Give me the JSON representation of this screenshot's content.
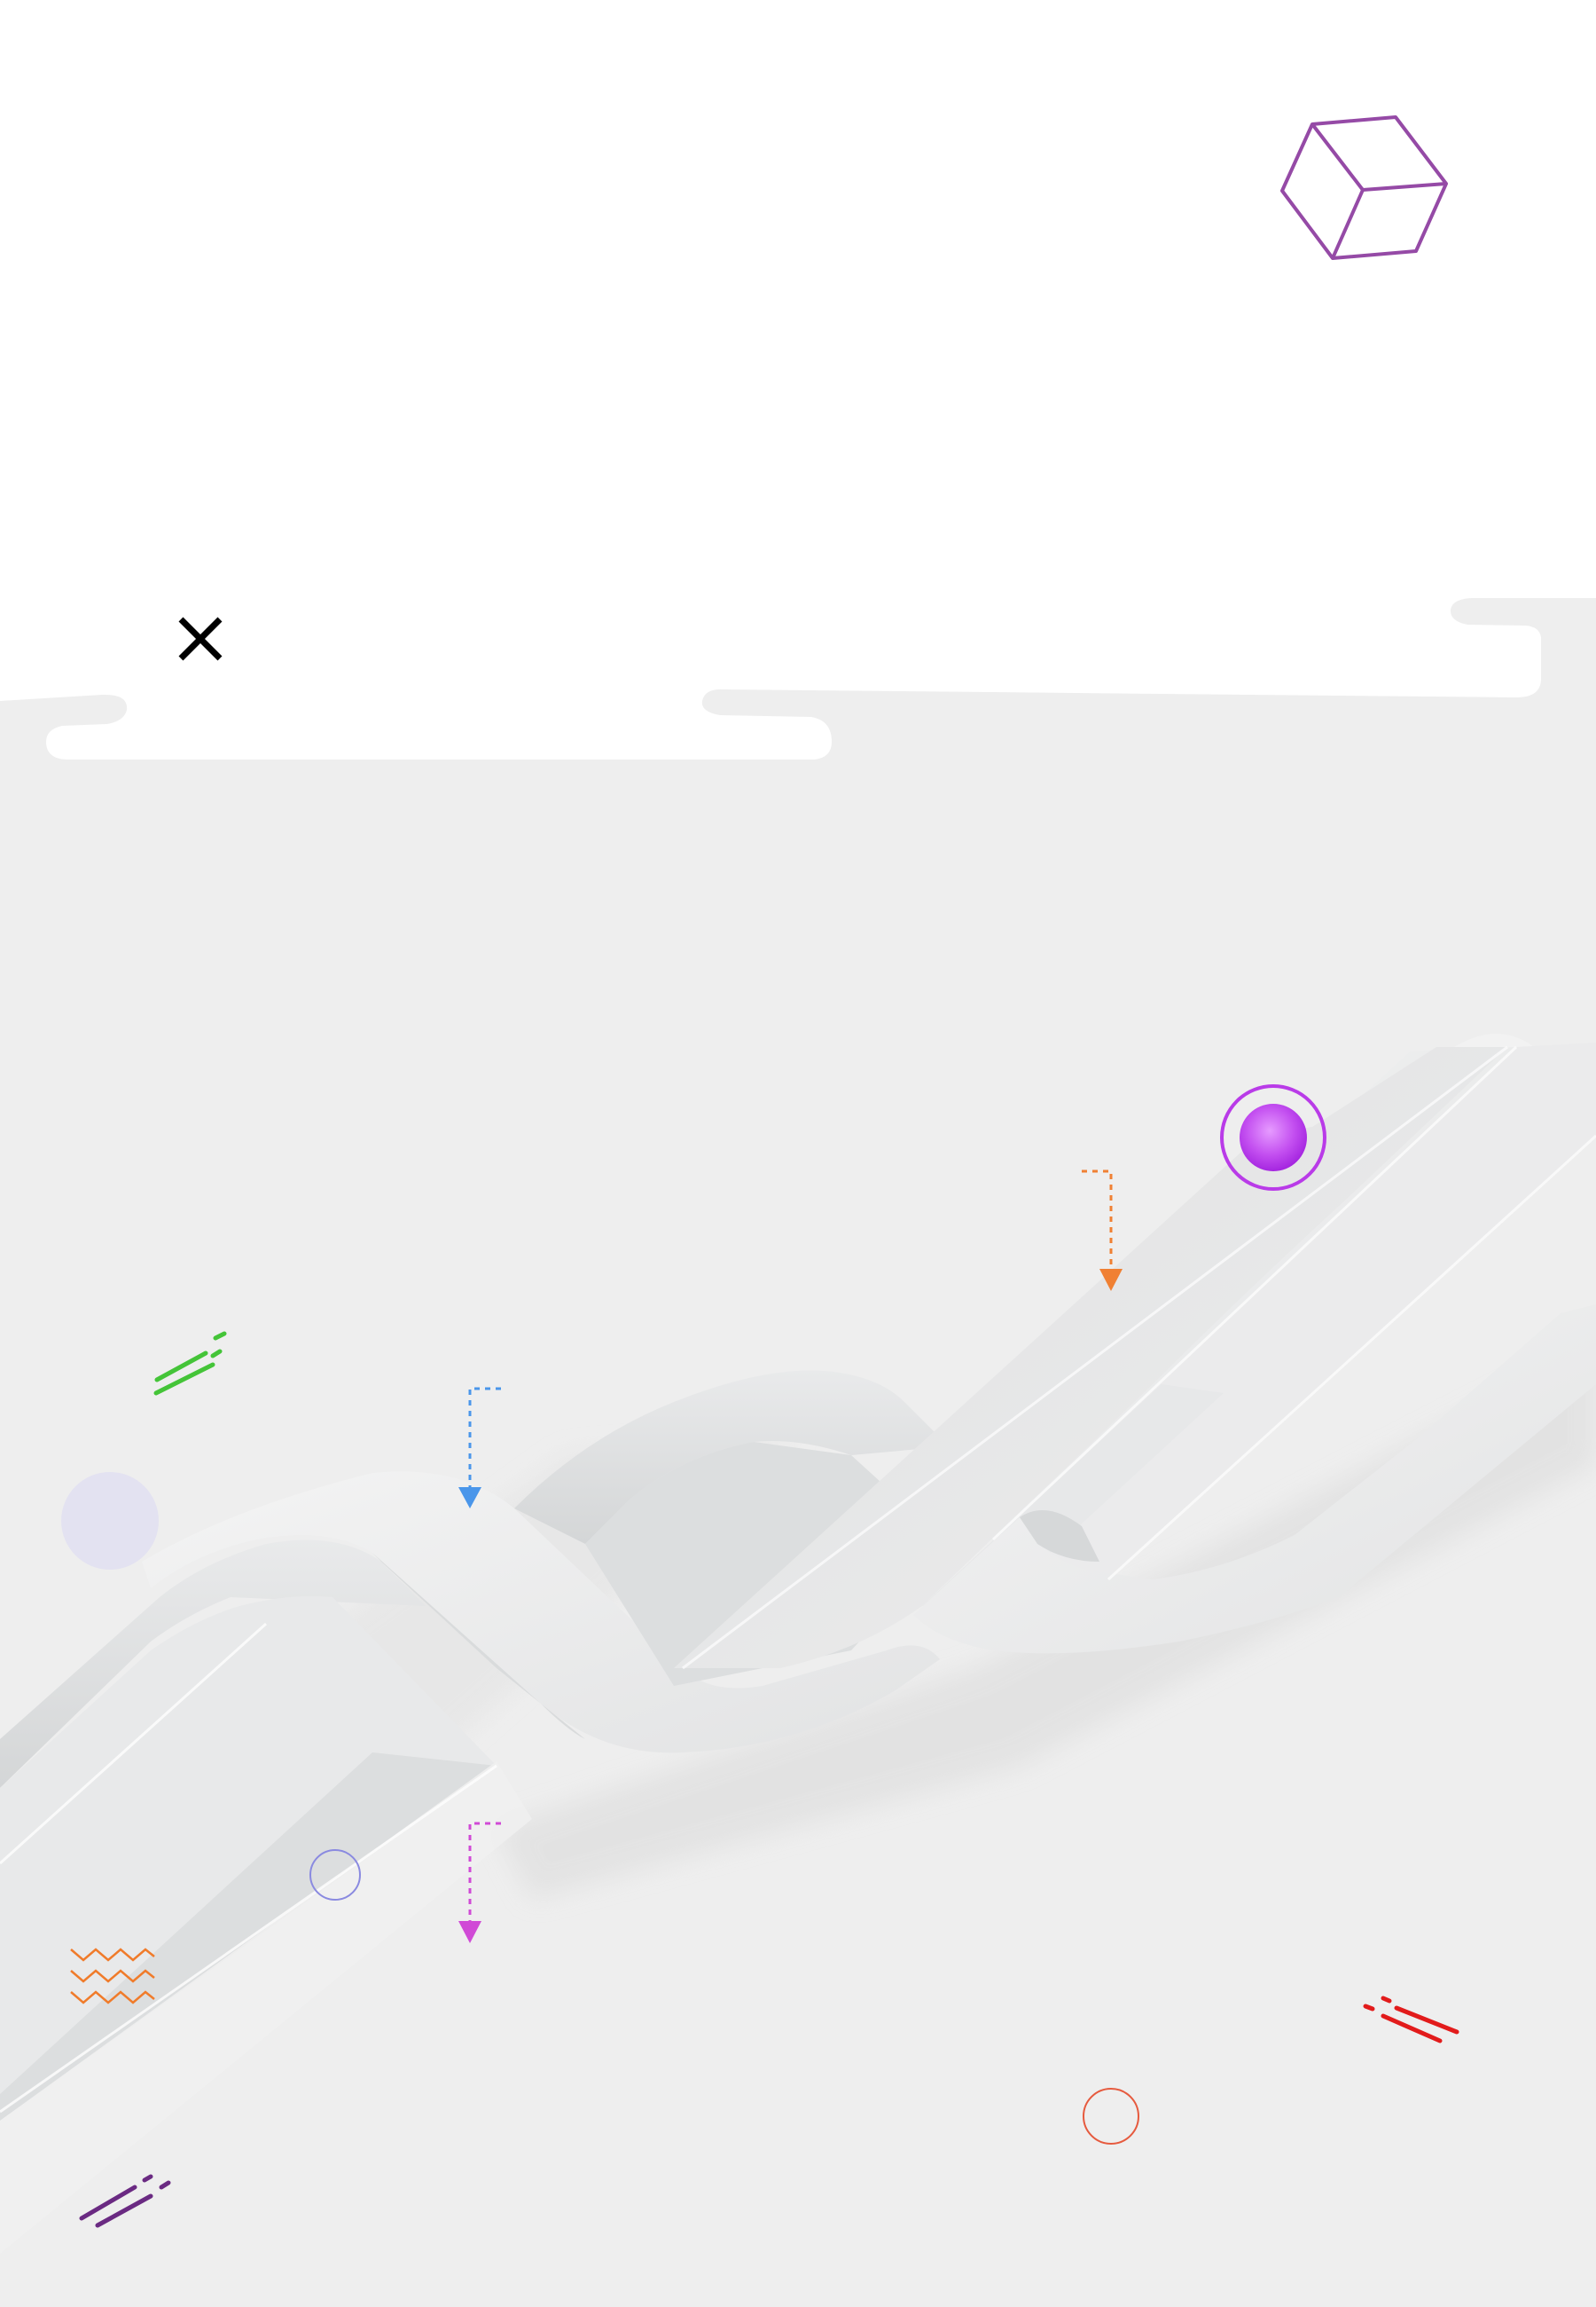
{
  "scene": {
    "background": "#ffffff",
    "panel_color": "#eeeeee",
    "ribbon_light": "#f1f1f1",
    "ribbon_mid": "#e5e6e7",
    "ribbon_dark": "#d6d8d9",
    "accent_colors": {
      "cube": "#954aa6",
      "orb": "#c34ff0",
      "orb_ring": "#b93be8",
      "arrow_orange": "#f08033",
      "arrow_blue": "#4a96ea",
      "arrow_magenta": "#d04ad6",
      "dash_green": "#44c438",
      "dash_red": "#e21b1b",
      "dash_purple": "#6a2a82",
      "zigzag_orange": "#f07b2a",
      "circle_lavender": "#e3e2f1",
      "circle_blue_outline": "#8a8ae0",
      "circle_red_outline": "#e65a3e"
    }
  },
  "close": {
    "icon": "close-icon",
    "color": "#000000"
  }
}
